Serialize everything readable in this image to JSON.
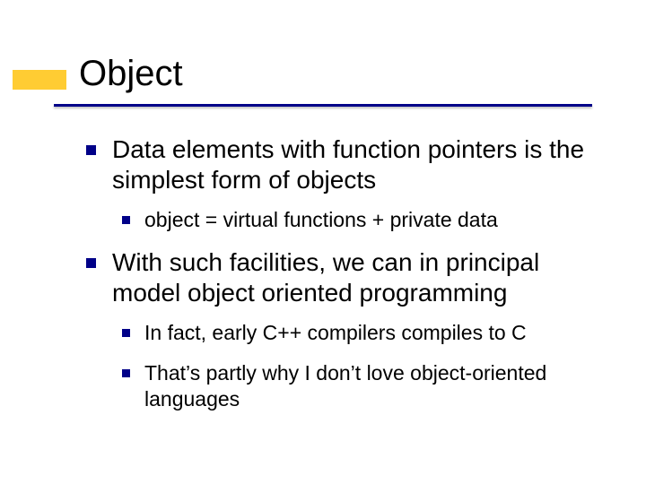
{
  "title": "Object",
  "bullets": {
    "b1": "Data elements with function pointers is the simplest form of objects",
    "b1a": "object = virtual functions + private data",
    "b2": "With such facilities, we can in principal model object oriented programming",
    "b2a": "In fact, early C++ compilers compiles to C",
    "b2b": "That’s partly why I don’t love object-oriented languages"
  }
}
